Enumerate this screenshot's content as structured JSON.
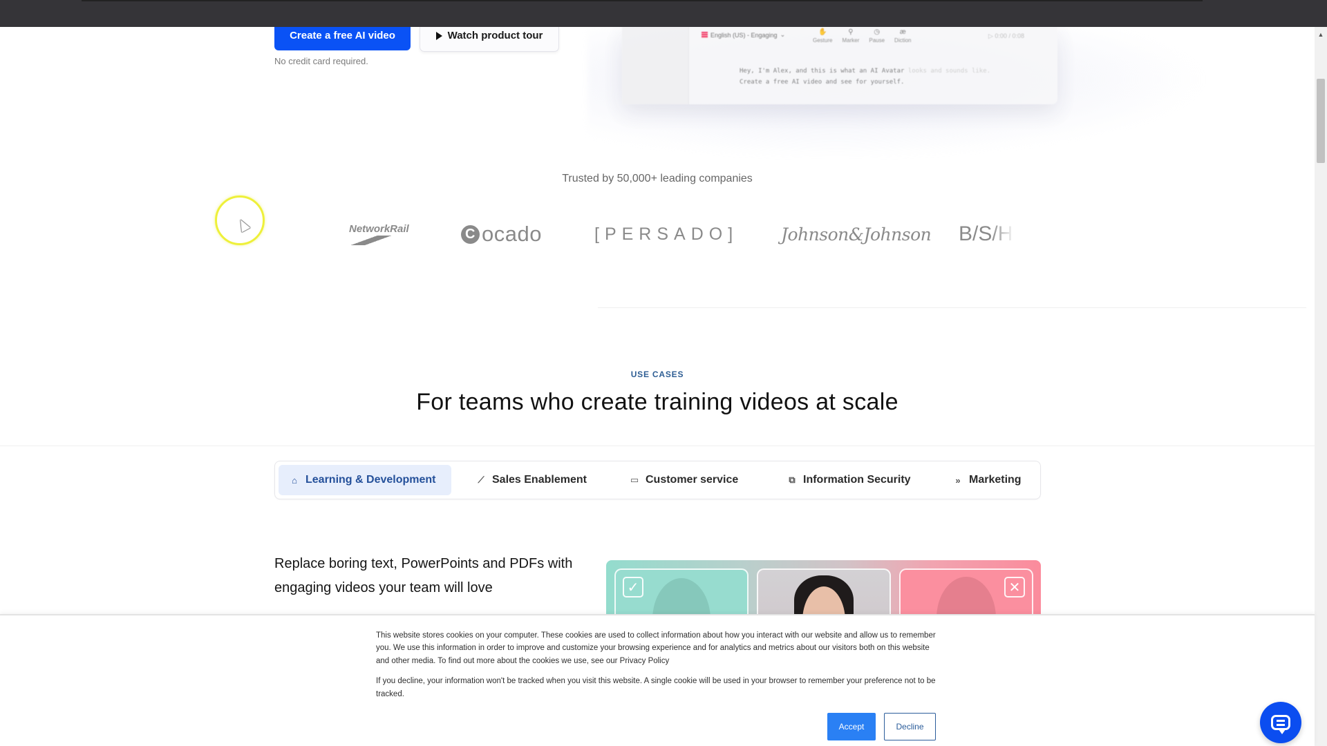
{
  "hero": {
    "primary_cta": "Create a free AI video",
    "secondary_cta": "Watch product tour",
    "secondary_cta_icon": "play-icon",
    "note": "No credit card required."
  },
  "editor_preview": {
    "language": "English (US) - Engaging",
    "tools": [
      {
        "label": "Gesture",
        "icon": "gesture-icon",
        "glyph": "✋"
      },
      {
        "label": "Marker",
        "icon": "marker-icon",
        "glyph": "⚲"
      },
      {
        "label": "Pause",
        "icon": "pause-clock-icon",
        "glyph": "◷"
      },
      {
        "label": "Diction",
        "icon": "diction-icon",
        "glyph": "æ"
      }
    ],
    "time": "0:00 / 0:08",
    "script_line1": "Hey, I'm Alex, and this is what an AI Avatar",
    "script_line1_faded": "looks and sounds like.",
    "script_line2": "Create a free AI video and see for yourself."
  },
  "trusted": {
    "heading": "Trusted by 50,000+ leading companies",
    "logos": {
      "networkrail": "NetworkRail",
      "ocado_mark": "C",
      "ocado": "ocado",
      "persado": "[PERSADO]",
      "jnj": "Johnson&Johnson",
      "bsh": "B/S/H"
    }
  },
  "use_cases": {
    "eyebrow": "USE CASES",
    "title": "For teams who create training videos at scale",
    "tabs": [
      {
        "label": "Learning & Development",
        "icon": "building-icon",
        "glyph": "🏛",
        "active": true
      },
      {
        "label": "Sales Enablement",
        "icon": "line-chart-icon",
        "glyph": "📈",
        "active": false
      },
      {
        "label": "Customer service",
        "icon": "chat-bubble-icon",
        "glyph": "💬",
        "active": false
      },
      {
        "label": "Information Security",
        "icon": "devices-icon",
        "glyph": "🖥",
        "active": false
      },
      {
        "label": "Marketing",
        "icon": "fast-forward-icon",
        "glyph": "⏩",
        "active": false
      }
    ],
    "feature_text": "Replace boring text, PowerPoints and PDFs with engaging videos your team will love",
    "check_glyph": "✓",
    "x_glyph": "✕"
  },
  "cookie_banner": {
    "paragraph1": "This website stores cookies on your computer. These cookies are used to collect information about how you interact with our website and allow us to remember you. We use this information in order to improve and customize your browsing experience and for analytics and metrics about our visitors both on this website and other media. To find out more about the cookies we use, see our Privacy Policy",
    "paragraph2": "If you decline, your information won't be tracked when you visit this website. A single cookie will be used in your browser to remember your preference not to be tracked.",
    "accept": "Accept",
    "decline": "Decline"
  },
  "colors": {
    "primary": "#0a52f5",
    "eyebrow": "#2d5d93",
    "active_tab_bg": "#e7eefc",
    "cookie_accept": "#2a80f4"
  },
  "scrollbar": {
    "up_glyph": "▲"
  }
}
